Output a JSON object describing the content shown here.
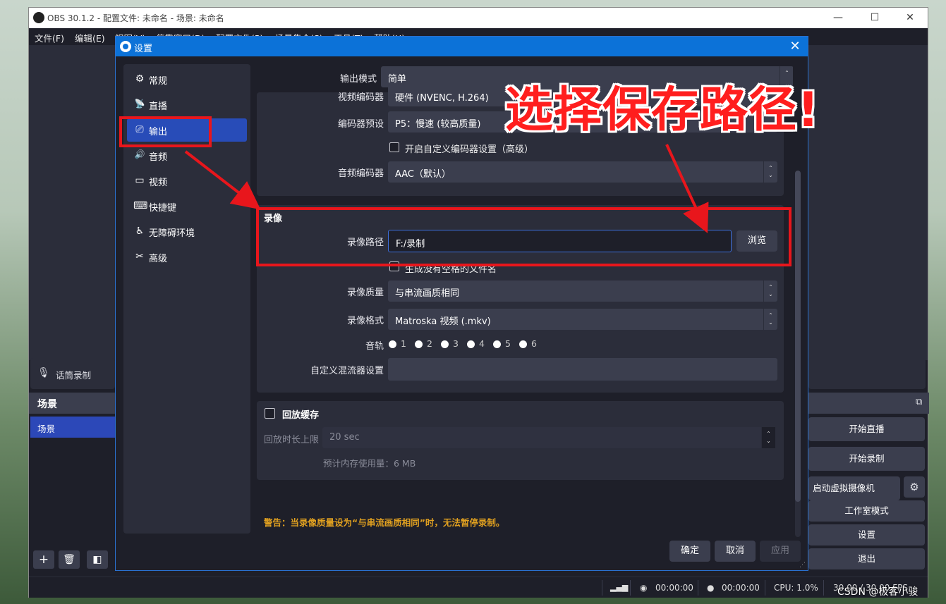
{
  "obs": {
    "title": "OBS 30.1.2 - 配置文件: 未命名 - 场景: 未命名",
    "window_controls": {
      "minimize": "—",
      "maximize": "☐",
      "close": "✕"
    },
    "menu": [
      "文件(F)",
      "编辑(E)",
      "视图(V)",
      "停靠窗口(D)",
      "配置文件(P)",
      "场景集合(S)",
      "工具(T)",
      "帮助(H)"
    ],
    "mic_label": "话筒录制",
    "scenes_header": "场景",
    "scene_item": "场景",
    "scene_tools": {
      "add": "+",
      "remove": "🗑",
      "filter": "◧"
    },
    "controls": {
      "start_stream": "开始直播",
      "start_record": "开始录制",
      "virtual_cam": "启动虚拟摄像机",
      "studio_mode": "工作室模式",
      "settings": "设置",
      "exit": "退出"
    },
    "status": {
      "stream_time": "00:00:00",
      "record_time": "00:00:00",
      "cpu": "CPU: 1.0%",
      "fps": "30.00 / 30.00 FPS"
    }
  },
  "dialog": {
    "title": "设置",
    "close": "✕",
    "sidebar": [
      {
        "label": "常规",
        "icon": "gear-icon",
        "glyph": "⚙"
      },
      {
        "label": "直播",
        "icon": "antenna-icon",
        "glyph": "📡"
      },
      {
        "label": "输出",
        "icon": "output-icon",
        "glyph": "⎚"
      },
      {
        "label": "音频",
        "icon": "speaker-icon",
        "glyph": "🔊"
      },
      {
        "label": "视频",
        "icon": "monitor-icon",
        "glyph": "▭"
      },
      {
        "label": "快捷键",
        "icon": "keyboard-icon",
        "glyph": "⌨"
      },
      {
        "label": "无障碍环境",
        "icon": "accessibility-icon",
        "glyph": "♿"
      },
      {
        "label": "高级",
        "icon": "tools-icon",
        "glyph": "✂"
      }
    ],
    "output_mode": {
      "label": "输出模式",
      "value": "简单"
    },
    "streaming": {
      "video_encoder": {
        "label": "视频编码器",
        "value": "硬件 (NVENC, H.264)"
      },
      "encoder_preset": {
        "label": "编码器预设",
        "value": "P5：慢速 (较高质量)"
      },
      "custom_encoder_checkbox": "开启自定义编码器设置（高级）",
      "audio_encoder": {
        "label": "音频编码器",
        "value": "AAC（默认）"
      }
    },
    "recording": {
      "section_title": "录像",
      "path_label": "录像路径",
      "path_value": "F:/录制",
      "browse": "浏览",
      "no_space_checkbox": "生成没有空格的文件名",
      "quality_label": "录像质量",
      "quality_value": "与串流画质相同",
      "format_label": "录像格式",
      "format_value": "Matroska 视频 (.mkv)",
      "tracks_label": "音轨",
      "tracks": [
        "1",
        "2",
        "3",
        "4",
        "5",
        "6"
      ],
      "muxer_label": "自定义混流器设置",
      "muxer_value": ""
    },
    "replay": {
      "title": "回放缓存",
      "length_label": "回放时长上限",
      "length_value": "20 sec",
      "memory_note": "预计内存使用量：6 MB"
    },
    "warning": "警告：当录像质量设为“与串流画质相同”时，无法暂停录制。",
    "buttons": {
      "ok": "确定",
      "cancel": "取消",
      "apply": "应用"
    }
  },
  "annotation": {
    "callout": "选择保存路径!"
  },
  "watermark": "CSDN @极客小骏",
  "colors": {
    "accent": "#284cb8",
    "titlebar": "#0c72d8",
    "annotation_red": "#e8161c",
    "warning": "#e0a020"
  }
}
